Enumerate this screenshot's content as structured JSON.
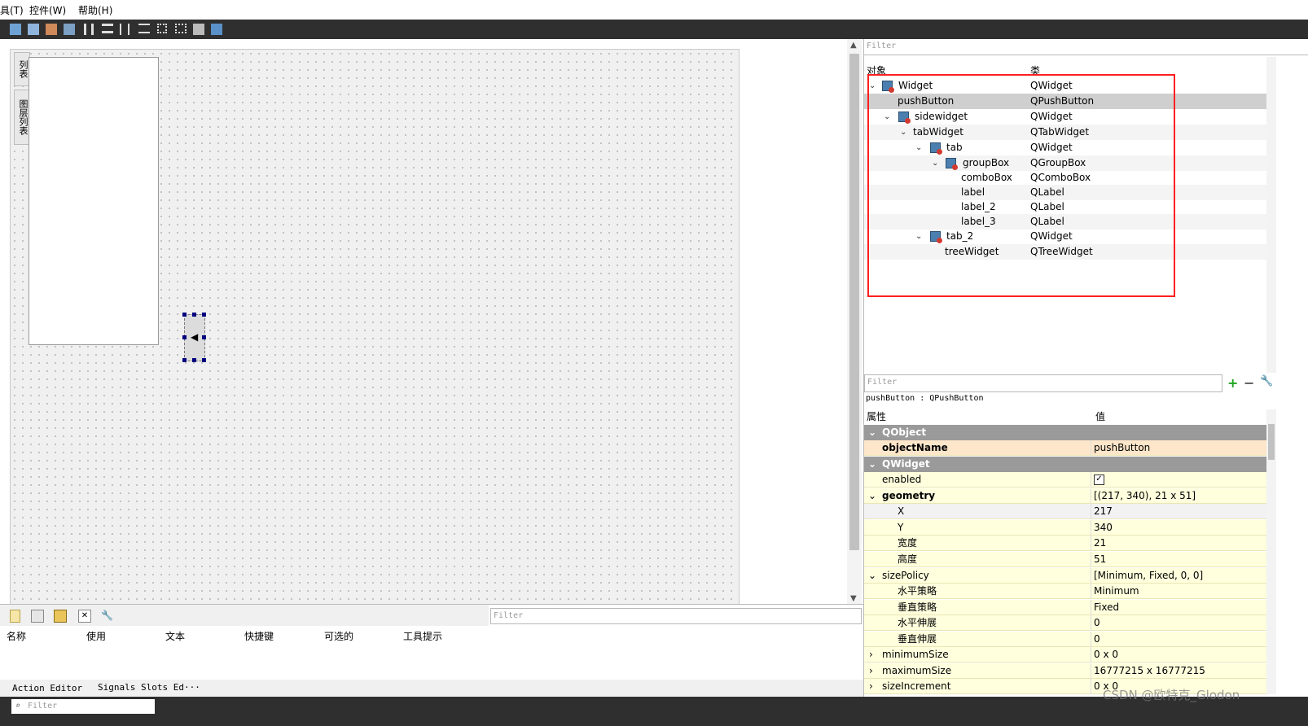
{
  "menu": {
    "item_tools": "具(T)",
    "item_widgets": "控件(W)",
    "item_help": "帮助(H)"
  },
  "sidebar_tabs": {
    "tab_list": "列表",
    "tab_layers": "图层列表"
  },
  "action_editor": {
    "filter_placeholder": "Filter",
    "columns": [
      "名称",
      "使用",
      "文本",
      "快捷键",
      "可选的",
      "工具提示"
    ]
  },
  "bottom_tabs": {
    "action_editor": "Action Editor",
    "signals_slots": "Signals Slots Ed···"
  },
  "status": {
    "filter_placeholder": "Filter"
  },
  "object_inspector": {
    "filter_placeholder": "Filter",
    "header_object": "对象",
    "header_class": "类",
    "rows": [
      {
        "name": "Widget",
        "cls": "QWidget"
      },
      {
        "name": "pushButton",
        "cls": "QPushButton"
      },
      {
        "name": "sidewidget",
        "cls": "QWidget"
      },
      {
        "name": "tabWidget",
        "cls": "QTabWidget"
      },
      {
        "name": "tab",
        "cls": "QWidget"
      },
      {
        "name": "groupBox",
        "cls": "QGroupBox"
      },
      {
        "name": "comboBox",
        "cls": "QComboBox"
      },
      {
        "name": "label",
        "cls": "QLabel"
      },
      {
        "name": "label_2",
        "cls": "QLabel"
      },
      {
        "name": "label_3",
        "cls": "QLabel"
      },
      {
        "name": "tab_2",
        "cls": "QWidget"
      },
      {
        "name": "treeWidget",
        "cls": "QTreeWidget"
      }
    ]
  },
  "property_editor": {
    "filter_placeholder": "Filter",
    "object_title": "pushButton : QPushButton",
    "header_property": "属性",
    "header_value": "值",
    "section_qobject": "QObject",
    "object_name_label": "objectName",
    "object_name_value": "pushButton",
    "section_qwidget": "QWidget",
    "enabled_label": "enabled",
    "enabled_check": "✓",
    "geometry_label": "geometry",
    "geometry_value": "[(217, 340), 21 x 51]",
    "x_label": "X",
    "x_value": "217",
    "y_label": "Y",
    "y_value": "340",
    "width_label": "宽度",
    "width_value": "21",
    "height_label": "高度",
    "height_value": "51",
    "sizepolicy_label": "sizePolicy",
    "sizepolicy_value": "[Minimum, Fixed, 0, 0]",
    "hpolicy_label": "水平策略",
    "hpolicy_value": "Minimum",
    "vpolicy_label": "垂直策略",
    "vpolicy_value": "Fixed",
    "hstretch_label": "水平伸展",
    "hstretch_value": "0",
    "vstretch_label": "垂直伸展",
    "vstretch_value": "0",
    "minsize_label": "minimumSize",
    "minsize_value": "0 x 0",
    "maxsize_label": "maximumSize",
    "maxsize_value": "16777215 x 16777215",
    "sizeinc_label": "sizeIncrement",
    "sizeinc_value": "0 x 0"
  },
  "watermark": "CSDN @欧特克_Glodon"
}
